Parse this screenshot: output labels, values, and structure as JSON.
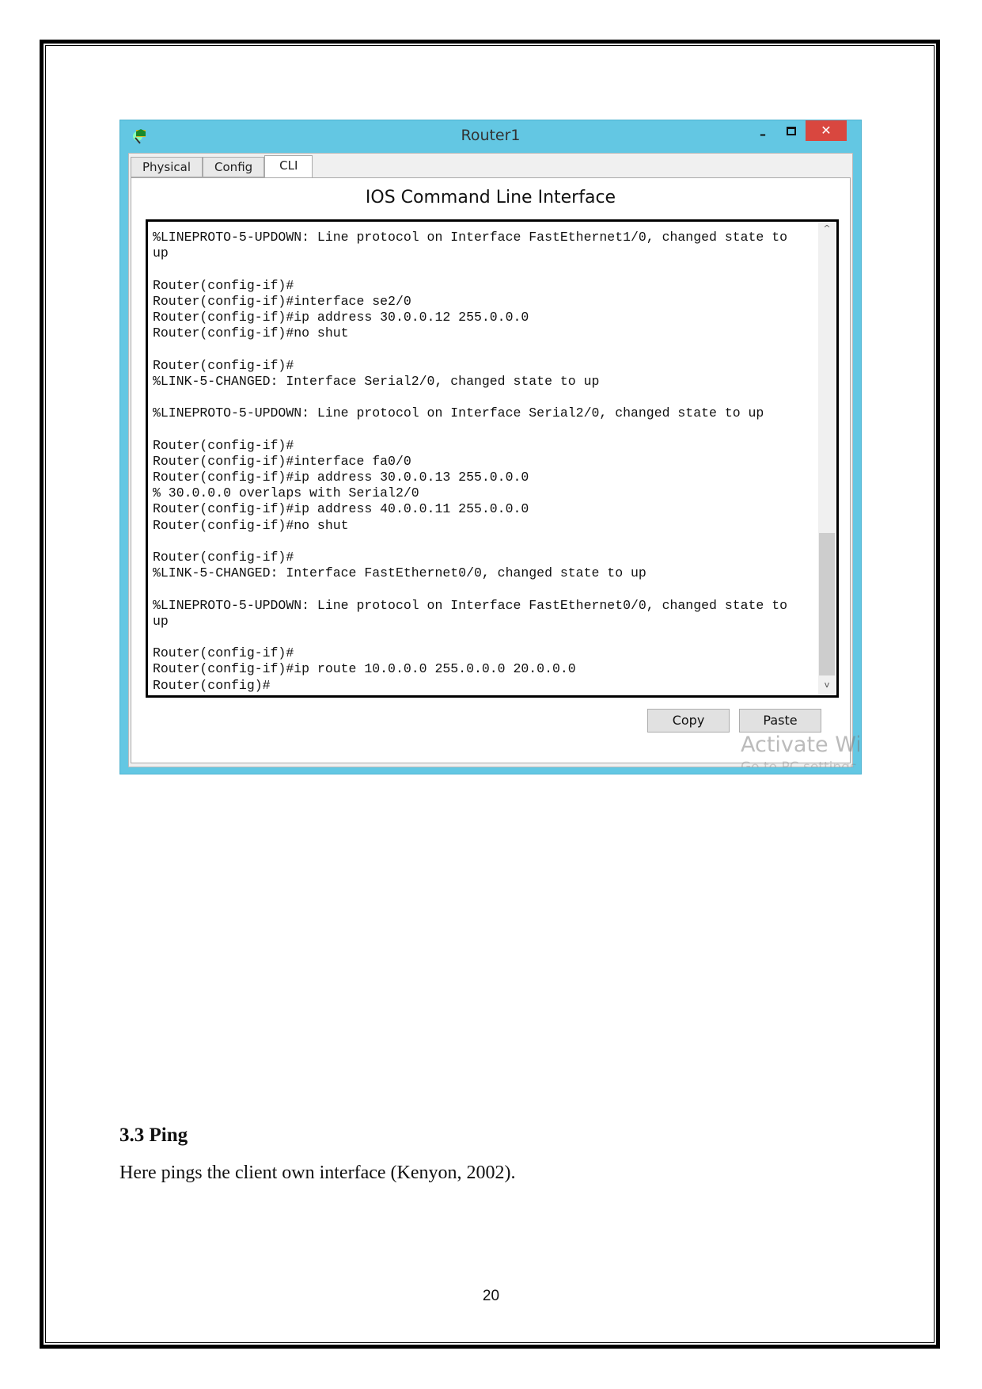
{
  "window": {
    "title": "Router1",
    "icons": {
      "app": "router-app-icon",
      "minimize": "minimize-icon",
      "maximize": "maximize-icon",
      "close": "close-icon"
    },
    "minimize_glyph": "–",
    "close_glyph": "✕",
    "tabs": [
      {
        "label": "Physical"
      },
      {
        "label": "Config"
      },
      {
        "label": "CLI",
        "active": true
      }
    ],
    "heading": "IOS Command Line Interface",
    "terminal_lines": [
      "%LINEPROTO-5-UPDOWN: Line protocol on Interface FastEthernet1/0, changed state to",
      "up",
      "",
      "Router(config-if)#",
      "Router(config-if)#interface se2/0",
      "Router(config-if)#ip address 30.0.0.12 255.0.0.0",
      "Router(config-if)#no shut",
      "",
      "Router(config-if)#",
      "%LINK-5-CHANGED: Interface Serial2/0, changed state to up",
      "",
      "%LINEPROTO-5-UPDOWN: Line protocol on Interface Serial2/0, changed state to up",
      "",
      "Router(config-if)#",
      "Router(config-if)#interface fa0/0",
      "Router(config-if)#ip address 30.0.0.13 255.0.0.0",
      "% 30.0.0.0 overlaps with Serial2/0",
      "Router(config-if)#ip address 40.0.0.11 255.0.0.0",
      "Router(config-if)#no shut",
      "",
      "Router(config-if)#",
      "%LINK-5-CHANGED: Interface FastEthernet0/0, changed state to up",
      "",
      "%LINEPROTO-5-UPDOWN: Line protocol on Interface FastEthernet0/0, changed state to",
      "up",
      "",
      "Router(config-if)#",
      "Router(config-if)#ip route 10.0.0.0 255.0.0.0 20.0.0.0",
      "Router(config)#"
    ],
    "scroll_up_glyph": "^",
    "scroll_down_glyph": "v",
    "copy_label": "Copy",
    "paste_label": "Paste",
    "watermark_line1": "Activate Windows",
    "watermark_line2": "Go to PC settings"
  },
  "document": {
    "section_heading": "3.3  Ping",
    "paragraph": "Here pings the client own interface (Kenyon, 2002).",
    "page_number": "20"
  },
  "colors": {
    "titlebar": "#63c7e3",
    "close": "#d9473f"
  }
}
